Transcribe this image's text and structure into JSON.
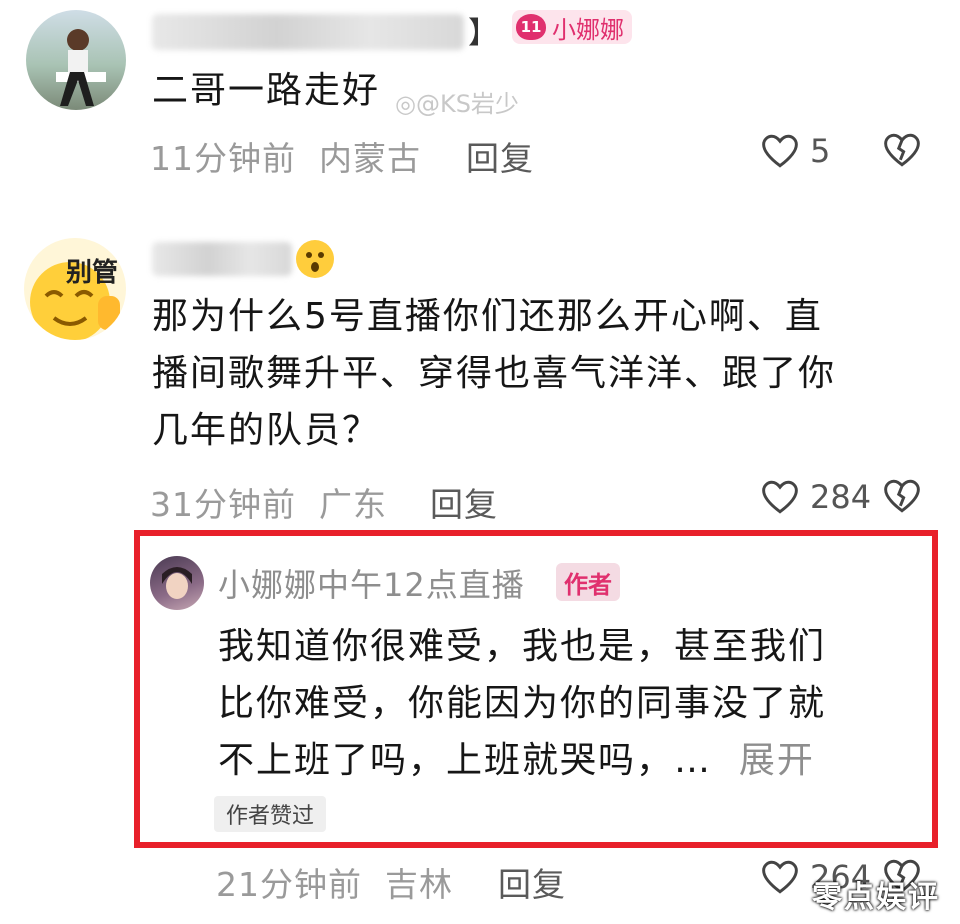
{
  "comments": [
    {
      "text": "二哥一路走好",
      "level": "11",
      "mention": "小娜娜",
      "time": "11分钟前",
      "location": "内蒙古",
      "reply_label": "回复",
      "likes": "5"
    },
    {
      "text": "那为什么5号直播你们还那么开心啊、直播间歌舞升平、穿得也喜气洋洋、跟了你几年的队员？",
      "lines": [
        "那为什么5号直播你们还那么开心啊、直",
        "播间歌舞升平、穿得也喜气洋洋、跟了你",
        "几年的队员？"
      ],
      "avatar_text": "别管",
      "time": "31分钟前",
      "location": "广东",
      "reply_label": "回复",
      "likes": "284"
    }
  ],
  "reply": {
    "username": "小娜娜中午12点直播",
    "author_tag": "作者",
    "lines": [
      "我知道你很难受，我也是，甚至我们",
      "比你难受，你能因为你的同事没了就",
      "不上班了吗，上班就哭吗，…"
    ],
    "expand": "展开",
    "liked_by_author": "作者赞过",
    "time": "21分钟前",
    "location": "吉林",
    "reply_label": "回复",
    "likes": "264"
  },
  "watermarks": {
    "weibo": "@KS岩少",
    "corner": "零点娱评"
  },
  "colors": {
    "accent_pink": "#e0306e",
    "highlight_red": "#e8202a"
  }
}
